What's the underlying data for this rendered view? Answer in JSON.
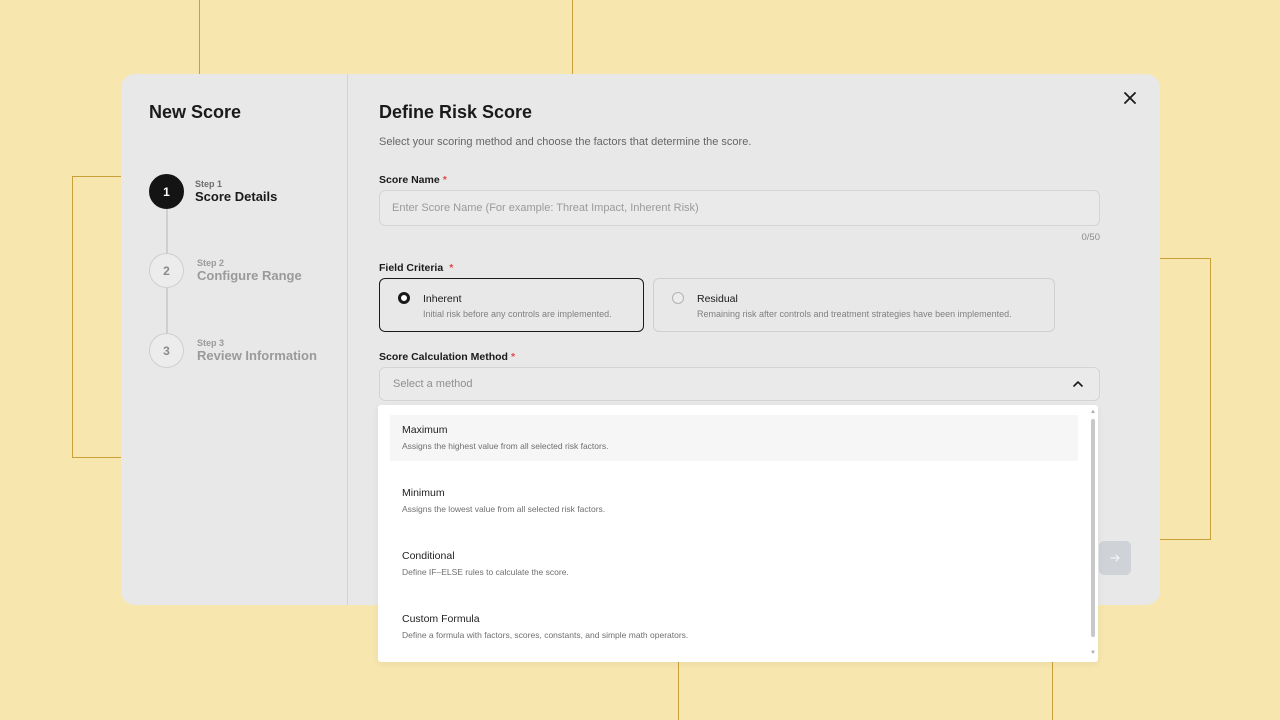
{
  "sidebar": {
    "title": "New Score",
    "steps": [
      {
        "number": "1",
        "small": "Step 1",
        "name": "Score Details",
        "active": true
      },
      {
        "number": "2",
        "small": "Step 2",
        "name": "Configure Range",
        "active": false
      },
      {
        "number": "3",
        "small": "Step 3",
        "name": "Review Information",
        "active": false
      }
    ]
  },
  "main": {
    "title": "Define Risk Score",
    "subtitle": "Select your scoring method and choose the factors that determine the score.",
    "score_name": {
      "label": "Score Name",
      "required_mark": "*",
      "placeholder": "Enter Score Name (For example: Threat Impact, Inherent Risk)",
      "value": "",
      "counter": "0/50"
    },
    "field_criteria": {
      "label": "Field Criteria",
      "required_mark": "*",
      "options": [
        {
          "title": "Inherent",
          "desc": "Initial risk before any controls are implemented.",
          "selected": true
        },
        {
          "title": "Residual",
          "desc": "Remaining risk after controls and treatment strategies have been implemented.",
          "selected": false
        }
      ]
    },
    "calc_method": {
      "label": "Score Calculation Method",
      "required_mark": "*",
      "placeholder": "Select a method",
      "options": [
        {
          "title": "Maximum",
          "desc": "Assigns the highest value from all selected risk factors."
        },
        {
          "title": "Minimum",
          "desc": "Assigns the lowest value from all selected risk factors."
        },
        {
          "title": "Conditional",
          "desc": "Define IF–ELSE rules to calculate the score."
        },
        {
          "title": "Custom Formula",
          "desc": "Define a formula with factors, scores, constants, and simple math operators."
        }
      ]
    },
    "next_icon": "arrow-right-icon",
    "close_icon": "close-icon"
  },
  "colors": {
    "background": "#f7e7ae",
    "modal": "#e8e8e8",
    "active_step": "#141414",
    "required": "#e5484d"
  }
}
